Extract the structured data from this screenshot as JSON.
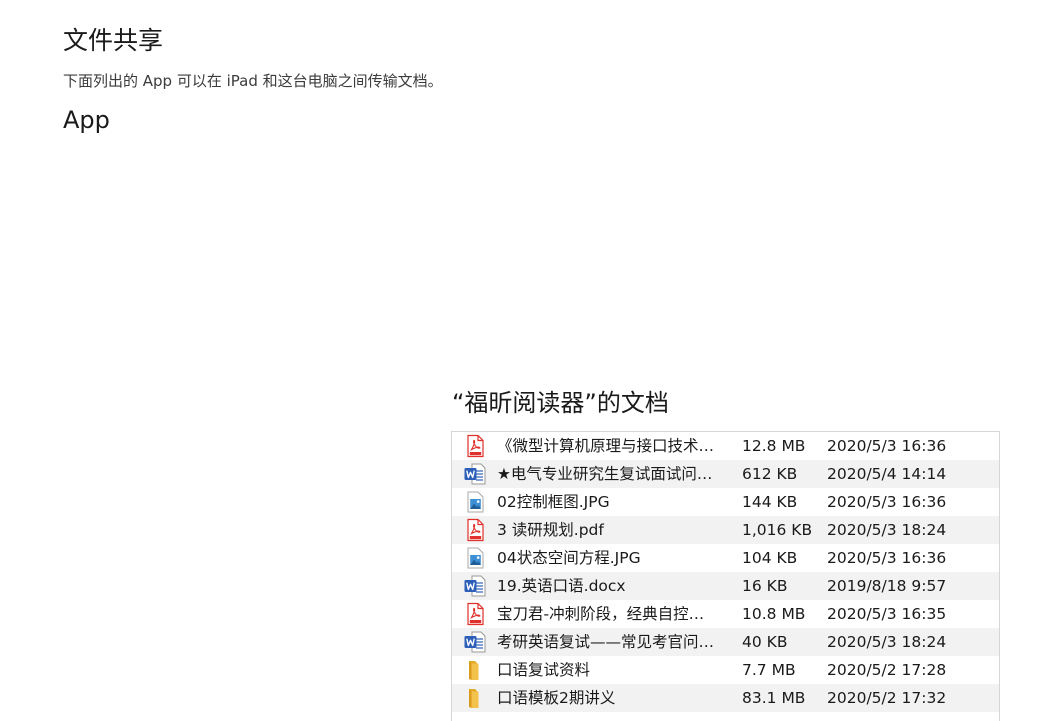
{
  "header": {
    "title": "文件共享",
    "subtitle": "下面列出的 App 可以在 iPad 和这台电脑之间传输文档。"
  },
  "apps": {
    "heading": "App",
    "items": []
  },
  "documents": {
    "heading": "“福昕阅读器”的文档",
    "files": [
      {
        "name": "《微型计算机原理与接口技术…",
        "size": "12.8 MB",
        "date": "2020/5/3 16:36",
        "icon": "pdf-icon"
      },
      {
        "name": "★电气专业研究生复试面试问…",
        "size": "612 KB",
        "date": "2020/5/4 14:14",
        "icon": "word-icon"
      },
      {
        "name": "02控制框图.JPG",
        "size": "144 KB",
        "date": "2020/5/3 16:36",
        "icon": "image-icon"
      },
      {
        "name": "3 读研规划.pdf",
        "size": "1,016 KB",
        "date": "2020/5/3 18:24",
        "icon": "pdf-icon"
      },
      {
        "name": "04状态空间方程.JPG",
        "size": "104 KB",
        "date": "2020/5/3 16:36",
        "icon": "image-icon"
      },
      {
        "name": "19.英语口语.docx",
        "size": "16 KB",
        "date": "2019/8/18 9:57",
        "icon": "word-icon"
      },
      {
        "name": "宝刀君-冲刺阶段，经典自控…",
        "size": "10.8 MB",
        "date": "2020/5/3 16:35",
        "icon": "pdf-icon"
      },
      {
        "name": "考研英语复试——常见考官问…",
        "size": "40 KB",
        "date": "2020/5/3 18:24",
        "icon": "word-icon"
      },
      {
        "name": "口语复试资料",
        "size": "7.7 MB",
        "date": "2020/5/2 17:28",
        "icon": "folder-icon"
      },
      {
        "name": "口语模板2期讲义",
        "size": "83.1 MB",
        "date": "2020/5/2 17:32",
        "icon": "folder-icon"
      }
    ]
  },
  "colors": {
    "pdf": "#e0312c",
    "word": "#2b5fb8",
    "image_sky": "#3d8fd6",
    "folder": "#f3c24a",
    "row_alt": "#f2f2f2"
  }
}
